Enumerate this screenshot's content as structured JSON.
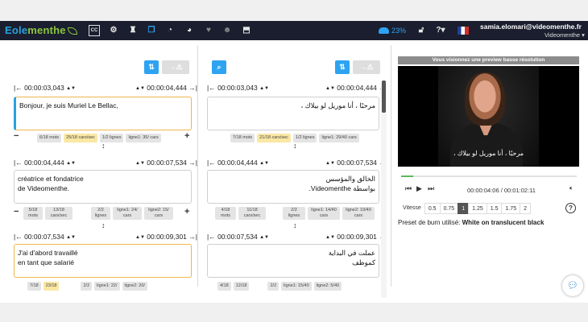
{
  "nav": {
    "brand_a": "Eole",
    "brand_b": "menthe",
    "storage_pct": "23%",
    "user_email": "samia.elomari@videomenthe.fr",
    "user_org": "Videomenthe",
    "icons": [
      "cc-icon",
      "settings-icon",
      "binoculars-icon",
      "copy-icon",
      "dashboard-icon",
      "pie-chart-icon",
      "heart-icon",
      "users-icon",
      "export-icon"
    ]
  },
  "editor": {
    "left_column": [
      {
        "start": "00:00:03,043",
        "end": "00:00:04,444",
        "lines": [
          "Bonjour, je suis Muriel Le Bellac,"
        ],
        "badges": [
          "6/18 mots",
          "25/18 cars/sec",
          "1/2 lignes",
          "ligne1: 35/ cars"
        ]
      },
      {
        "start": "00:00:04,444",
        "end": "00:00:07,534",
        "lines": [
          "créatrice et fondatrice",
          "de Videomenthe."
        ],
        "badges": [
          "5/18 mots",
          "13/18 cars/sec",
          "2/2 lignes",
          "ligne1: 24/ cars",
          "ligne2: 15/ cars"
        ]
      },
      {
        "start": "00:00:07,534",
        "end": "00:00:09,301",
        "lines": [
          "J'ai d'abord travaillé",
          "en tant que salarié"
        ],
        "badges": [
          "7/18",
          "23/18",
          "2/2",
          "ligne1: 22/",
          "ligne2: 20/"
        ]
      }
    ],
    "right_column": [
      {
        "start": "00:00:03,043",
        "end": "00:00:04,444",
        "lines": [
          "مرحبًا ، أنا موريل لو بيلاك ،"
        ],
        "badges": [
          "7/18 mots",
          "21/18 cars/sec",
          "1/2 lignes",
          "ligne1: 29/40 cars"
        ]
      },
      {
        "start": "00:00:04,444",
        "end": "00:00:07,534",
        "lines": [
          "الخالق والمؤسس",
          "بواسطة Videomenthe."
        ],
        "badges": [
          "4/18 mots",
          "11/18 cars/sec",
          "2/2 lignes",
          "ligne1: 14/40 cars",
          "ligne2: 19/40 cars"
        ]
      },
      {
        "start": "00:00:07,534",
        "end": "00:00:09,301",
        "lines": [
          "عملت في البداية",
          "كموظف"
        ],
        "badges": [
          "4/18",
          "12/18",
          "2/2",
          "ligne1: 15/40",
          "ligne2: 5/40"
        ]
      }
    ]
  },
  "preview": {
    "title": "Vous visionnez une preview basse résolution",
    "caption": "مرحبًا ، أنا موريل لو بيلاك ،",
    "timecode": "00:00:04:06 / 00:01:02:11",
    "speed_label": "Vitesse",
    "speeds": [
      "0.5",
      "0.75",
      "1",
      "1.25",
      "1.5",
      "1.75",
      "2"
    ],
    "selected_speed": "1",
    "preset_label": "Preset de burn utilisé: ",
    "preset_value": "White on translucent black",
    "progress": 0.07
  },
  "colors": {
    "accent": "#2ea3f2",
    "active_border": "#f0b44c",
    "nav_bg": "#1b1e2e"
  }
}
